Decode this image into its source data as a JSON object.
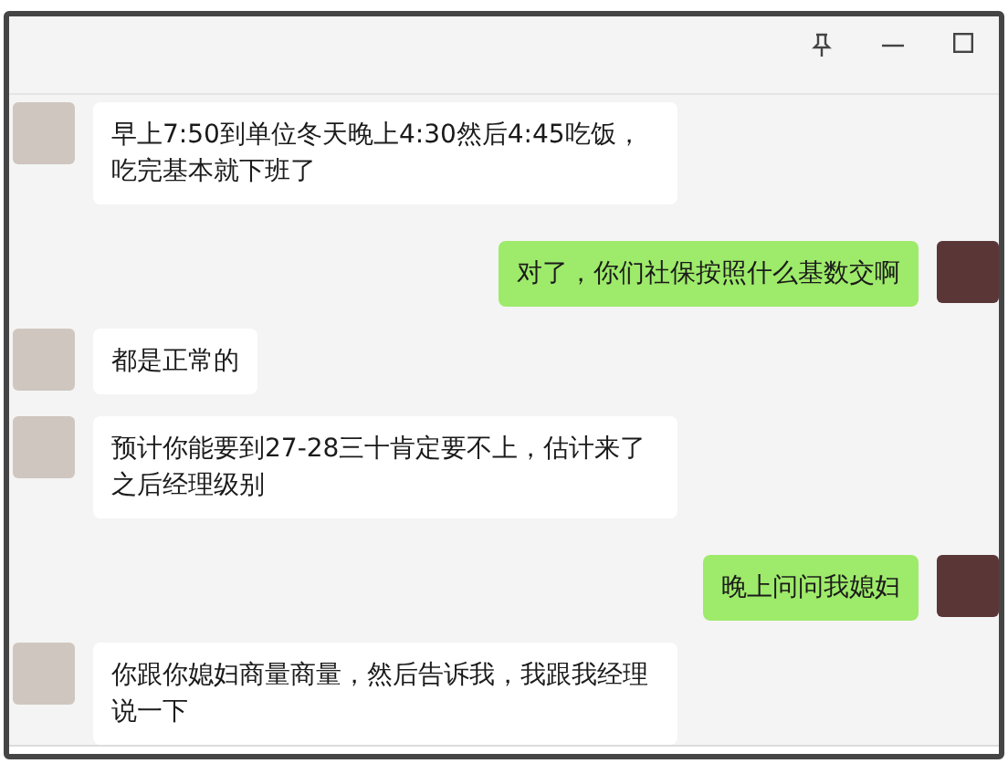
{
  "messages": [
    {
      "kind": "received",
      "text": "早上7:50到单位冬天晚上4:30然后4:45吃饭，吃完基本就下班了"
    },
    {
      "kind": "sent",
      "text": "对了，你们社保按照什么基数交啊"
    },
    {
      "kind": "received",
      "text": "都是正常的"
    },
    {
      "kind": "received",
      "text": "预计你能要到27-28三十肯定要不上，估计来了之后经理级别"
    },
    {
      "kind": "sent",
      "text": "晚上问问我媳妇"
    },
    {
      "kind": "received",
      "text": "你跟你媳妇商量商量，然后告诉我，我跟我经理说一下"
    }
  ]
}
